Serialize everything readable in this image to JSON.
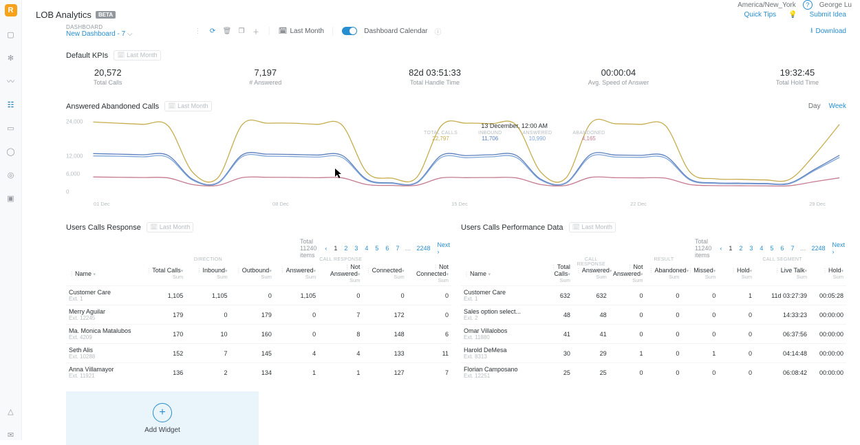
{
  "topbar": {
    "tz": "America/New_York",
    "user": "George Lu"
  },
  "title": {
    "text": "LOB Analytics",
    "badge": "BETA"
  },
  "actions": {
    "quick_tips": "Quick Tips",
    "submit_idea": "Submit Idea",
    "download": "Download"
  },
  "dash": {
    "crumb_label": "DASHBOARD",
    "name": "New Dashboard - 7",
    "period": "Last Month",
    "calendar_label": "Dashboard Calendar"
  },
  "kpi_section": {
    "title": "Default KPIs",
    "period": "Last Month"
  },
  "kpis": [
    {
      "value": "20,572",
      "label": "Total Calls"
    },
    {
      "value": "7,197",
      "label": "# Answered"
    },
    {
      "value": "82d 03:51:33",
      "label": "Total Handle Time"
    },
    {
      "value": "00:00:04",
      "label": "Avg. Speed of Answer"
    },
    {
      "value": "19:32:45",
      "label": "Total Hold Time"
    }
  ],
  "chart": {
    "title": "Answered Abandoned Calls",
    "period": "Last Month",
    "tabs": {
      "day": "Day",
      "week": "Week",
      "active": "week"
    },
    "tooltip": {
      "date": "13 December, 12:00 AM",
      "items": [
        {
          "label": "TOTAL CALLS",
          "value": "22,797",
          "cls": "tc"
        },
        {
          "label": "INBOUND",
          "value": "11,706",
          "cls": "ib"
        },
        {
          "label": "ANSWERED",
          "value": "10,990",
          "cls": "an"
        },
        {
          "label": "ABANDONED",
          "value": "4,165",
          "cls": "ab"
        }
      ]
    }
  },
  "chart_data": {
    "type": "line",
    "x": [
      "01 Dec",
      "02",
      "03",
      "04",
      "05",
      "06",
      "07",
      "08 Dec",
      "09",
      "10",
      "11",
      "12",
      "13",
      "14",
      "15 Dec",
      "16",
      "17",
      "18",
      "19",
      "20",
      "21",
      "22 Dec",
      "23",
      "24",
      "25",
      "26",
      "27",
      "28",
      "29 Dec",
      "30",
      "31"
    ],
    "x_ticks": [
      "01 Dec",
      "08 Dec",
      "15 Dec",
      "22 Dec",
      "29 Dec"
    ],
    "ylim": [
      0,
      24000
    ],
    "y_ticks": [
      0,
      6000,
      12000,
      24000
    ],
    "series": [
      {
        "name": "Total Calls",
        "color": "#c7ac4d",
        "values": [
          23200,
          22800,
          22400,
          22000,
          6000,
          4000,
          22400,
          22800,
          22800,
          22400,
          22200,
          6000,
          4000,
          4200,
          22000,
          22797,
          22600,
          22200,
          6000,
          4000,
          22800,
          22600,
          22400,
          22000,
          6000,
          3800,
          3600,
          3400,
          3600,
          12000,
          22400
        ]
      },
      {
        "name": "Inbound",
        "color": "#5a7fbf",
        "values": [
          12400,
          12200,
          12000,
          11800,
          3600,
          2400,
          12000,
          12200,
          12100,
          11900,
          11800,
          3600,
          2400,
          2500,
          11800,
          11706,
          12000,
          11800,
          3600,
          2400,
          12100,
          11900,
          11800,
          11600,
          3600,
          2400,
          2300,
          2200,
          2300,
          7000,
          11800
        ]
      },
      {
        "name": "Answered",
        "color": "#7fa5d8",
        "values": [
          11600,
          11500,
          11300,
          11100,
          3300,
          2200,
          11400,
          11500,
          11400,
          11200,
          11100,
          3300,
          2200,
          2300,
          11100,
          10990,
          11300,
          11100,
          3300,
          2200,
          11400,
          11200,
          11100,
          10900,
          3300,
          2200,
          2100,
          2000,
          2100,
          6600,
          11100
        ]
      },
      {
        "name": "Abandoned",
        "color": "#c57a8f",
        "values": [
          4400,
          4300,
          4200,
          4100,
          1800,
          1500,
          4200,
          4300,
          4250,
          4150,
          4100,
          1800,
          1500,
          1550,
          4100,
          4165,
          4200,
          4100,
          1800,
          1500,
          4250,
          4150,
          4100,
          4000,
          1800,
          1450,
          1400,
          1350,
          1400,
          2800,
          4100
        ]
      }
    ]
  },
  "ucr": {
    "title": "Users Calls Response",
    "period": "Last Month",
    "total": "Total 11240 items",
    "last_page": "2248",
    "next": "Next",
    "groups": {
      "direction": "DIRECTION",
      "call_response": "CALL RESPONSE"
    },
    "cols": {
      "name": "Name",
      "total": "Total Calls",
      "inbound": "Inbound",
      "outbound": "Outbound",
      "answered": "Answered",
      "not_answered": "Not Answered",
      "connected": "Connected",
      "not_connected": "Not Connected",
      "sum": "Sum"
    },
    "rows": [
      {
        "name": "Customer Care",
        "ext": "Ext. 1",
        "total": "1,105",
        "in": "1,105",
        "out": "0",
        "ans": "1,105",
        "nans": "0",
        "con": "0",
        "ncon": "0"
      },
      {
        "name": "Merry Aguilar",
        "ext": "Ext. 12245",
        "total": "179",
        "in": "0",
        "out": "179",
        "ans": "0",
        "nans": "7",
        "con": "172",
        "ncon": "0"
      },
      {
        "name": "Ma. Monica Matalubos",
        "ext": "Ext. 4209",
        "total": "170",
        "in": "10",
        "out": "160",
        "ans": "0",
        "nans": "8",
        "con": "148",
        "ncon": "6"
      },
      {
        "name": "Seth Alis",
        "ext": "Ext. 10288",
        "total": "152",
        "in": "7",
        "out": "145",
        "ans": "4",
        "nans": "4",
        "con": "133",
        "ncon": "11"
      },
      {
        "name": "Anna Villamayor",
        "ext": "Ext. 11921",
        "total": "136",
        "in": "2",
        "out": "134",
        "ans": "1",
        "nans": "1",
        "con": "127",
        "ncon": "7"
      }
    ]
  },
  "ucp": {
    "title": "Users Calls Performance Data",
    "period": "Last Month",
    "total": "Total 11240 items",
    "last_page": "2248",
    "next": "Next",
    "groups": {
      "call_response": "CALL RESPONSE",
      "result": "RESULT",
      "call_segment": "CALL SEGMENT"
    },
    "cols": {
      "name": "Name",
      "total": "Total Calls",
      "answered": "Answered",
      "not_answered": "Not Answered",
      "abandoned": "Abandoned",
      "missed": "Missed",
      "live_talk": "Live Talk",
      "hold": "Hold",
      "hold2": "Hold",
      "sum": "Sum"
    },
    "rows": [
      {
        "name": "Customer Care",
        "ext": "Ext. 1",
        "total": "632",
        "ans": "632",
        "nans": "0",
        "ab": "0",
        "ms": "0",
        "hold": "1",
        "lt": "11d 03:27:39",
        "hold2": "00:05:28"
      },
      {
        "name": "Sales option select...",
        "ext": "Ext. 2",
        "total": "48",
        "ans": "48",
        "nans": "0",
        "ab": "0",
        "ms": "0",
        "hold": "0",
        "lt": "14:33:23",
        "hold2": "00:00:00"
      },
      {
        "name": "Omar Villalobos",
        "ext": "Ext. 11880",
        "total": "41",
        "ans": "41",
        "nans": "0",
        "ab": "0",
        "ms": "0",
        "hold": "0",
        "lt": "06:37:56",
        "hold2": "00:00:00"
      },
      {
        "name": "Harold DeMesa",
        "ext": "Ext. 8313",
        "total": "30",
        "ans": "29",
        "nans": "1",
        "ab": "0",
        "ms": "1",
        "hold": "0",
        "lt": "04:14:48",
        "hold2": "00:00:00"
      },
      {
        "name": "Florian Camposano",
        "ext": "Ext. 12251",
        "total": "25",
        "ans": "25",
        "nans": "0",
        "ab": "0",
        "ms": "0",
        "hold": "0",
        "lt": "06:08:42",
        "hold2": "00:00:00"
      }
    ]
  },
  "add_widget": "Add Widget"
}
